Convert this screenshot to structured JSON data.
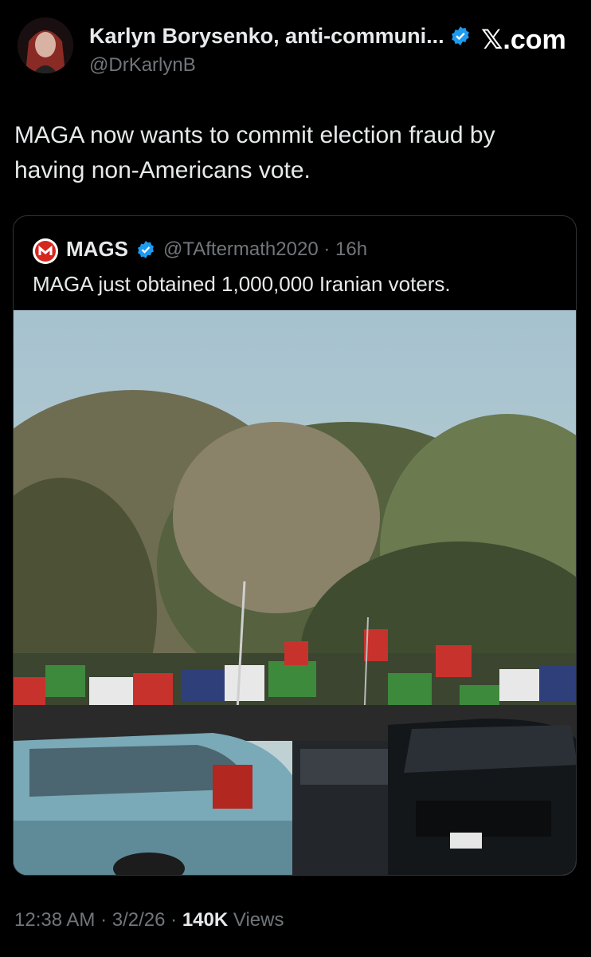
{
  "author": {
    "name": "Karlyn Borysenko, anti-communi...",
    "handle": "@DrKarlynB"
  },
  "brand": {
    "label": "𝕏.com"
  },
  "tweet": {
    "text": "MAGA now wants to commit election fraud by having non-Americans vote."
  },
  "quote": {
    "name": "MAGS",
    "handle": "@TAftermath2020",
    "dot": "·",
    "time": "16h",
    "text": "MAGA just obtained 1,000,000 Iranian voters."
  },
  "meta": {
    "time": "12:38 AM",
    "date": "3/2/26",
    "views_count": "140K",
    "views_label": "Views",
    "sep": "·"
  },
  "colors": {
    "background": "#000000",
    "text": "#e7e9ea",
    "muted": "#71767b",
    "verified": "#1d9bf0"
  }
}
